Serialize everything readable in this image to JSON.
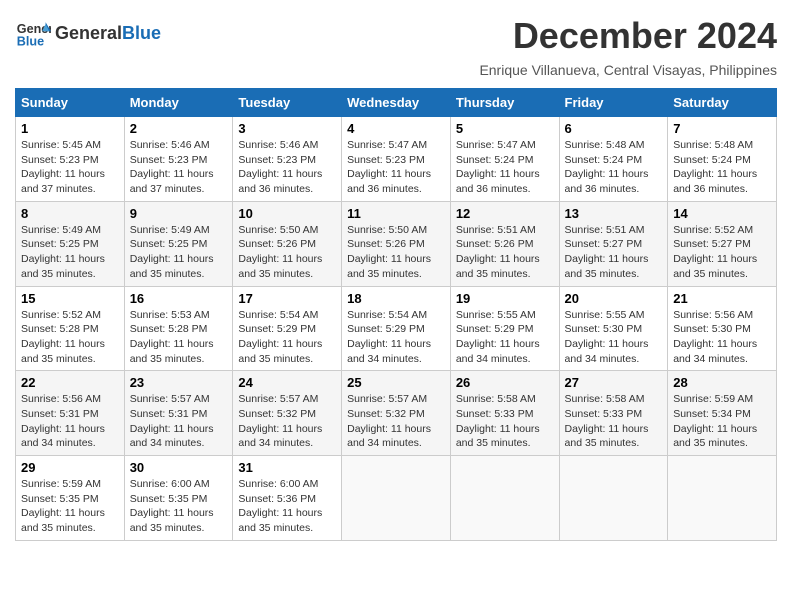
{
  "header": {
    "logo_general": "General",
    "logo_blue": "Blue",
    "month_title": "December 2024",
    "subtitle": "Enrique Villanueva, Central Visayas, Philippines"
  },
  "weekdays": [
    "Sunday",
    "Monday",
    "Tuesday",
    "Wednesday",
    "Thursday",
    "Friday",
    "Saturday"
  ],
  "weeks": [
    [
      {
        "day": "1",
        "sunrise": "5:45 AM",
        "sunset": "5:23 PM",
        "daylight": "11 hours and 37 minutes."
      },
      {
        "day": "2",
        "sunrise": "5:46 AM",
        "sunset": "5:23 PM",
        "daylight": "11 hours and 37 minutes."
      },
      {
        "day": "3",
        "sunrise": "5:46 AM",
        "sunset": "5:23 PM",
        "daylight": "11 hours and 36 minutes."
      },
      {
        "day": "4",
        "sunrise": "5:47 AM",
        "sunset": "5:23 PM",
        "daylight": "11 hours and 36 minutes."
      },
      {
        "day": "5",
        "sunrise": "5:47 AM",
        "sunset": "5:24 PM",
        "daylight": "11 hours and 36 minutes."
      },
      {
        "day": "6",
        "sunrise": "5:48 AM",
        "sunset": "5:24 PM",
        "daylight": "11 hours and 36 minutes."
      },
      {
        "day": "7",
        "sunrise": "5:48 AM",
        "sunset": "5:24 PM",
        "daylight": "11 hours and 36 minutes."
      }
    ],
    [
      {
        "day": "8",
        "sunrise": "5:49 AM",
        "sunset": "5:25 PM",
        "daylight": "11 hours and 35 minutes."
      },
      {
        "day": "9",
        "sunrise": "5:49 AM",
        "sunset": "5:25 PM",
        "daylight": "11 hours and 35 minutes."
      },
      {
        "day": "10",
        "sunrise": "5:50 AM",
        "sunset": "5:26 PM",
        "daylight": "11 hours and 35 minutes."
      },
      {
        "day": "11",
        "sunrise": "5:50 AM",
        "sunset": "5:26 PM",
        "daylight": "11 hours and 35 minutes."
      },
      {
        "day": "12",
        "sunrise": "5:51 AM",
        "sunset": "5:26 PM",
        "daylight": "11 hours and 35 minutes."
      },
      {
        "day": "13",
        "sunrise": "5:51 AM",
        "sunset": "5:27 PM",
        "daylight": "11 hours and 35 minutes."
      },
      {
        "day": "14",
        "sunrise": "5:52 AM",
        "sunset": "5:27 PM",
        "daylight": "11 hours and 35 minutes."
      }
    ],
    [
      {
        "day": "15",
        "sunrise": "5:52 AM",
        "sunset": "5:28 PM",
        "daylight": "11 hours and 35 minutes."
      },
      {
        "day": "16",
        "sunrise": "5:53 AM",
        "sunset": "5:28 PM",
        "daylight": "11 hours and 35 minutes."
      },
      {
        "day": "17",
        "sunrise": "5:54 AM",
        "sunset": "5:29 PM",
        "daylight": "11 hours and 35 minutes."
      },
      {
        "day": "18",
        "sunrise": "5:54 AM",
        "sunset": "5:29 PM",
        "daylight": "11 hours and 34 minutes."
      },
      {
        "day": "19",
        "sunrise": "5:55 AM",
        "sunset": "5:29 PM",
        "daylight": "11 hours and 34 minutes."
      },
      {
        "day": "20",
        "sunrise": "5:55 AM",
        "sunset": "5:30 PM",
        "daylight": "11 hours and 34 minutes."
      },
      {
        "day": "21",
        "sunrise": "5:56 AM",
        "sunset": "5:30 PM",
        "daylight": "11 hours and 34 minutes."
      }
    ],
    [
      {
        "day": "22",
        "sunrise": "5:56 AM",
        "sunset": "5:31 PM",
        "daylight": "11 hours and 34 minutes."
      },
      {
        "day": "23",
        "sunrise": "5:57 AM",
        "sunset": "5:31 PM",
        "daylight": "11 hours and 34 minutes."
      },
      {
        "day": "24",
        "sunrise": "5:57 AM",
        "sunset": "5:32 PM",
        "daylight": "11 hours and 34 minutes."
      },
      {
        "day": "25",
        "sunrise": "5:57 AM",
        "sunset": "5:32 PM",
        "daylight": "11 hours and 34 minutes."
      },
      {
        "day": "26",
        "sunrise": "5:58 AM",
        "sunset": "5:33 PM",
        "daylight": "11 hours and 35 minutes."
      },
      {
        "day": "27",
        "sunrise": "5:58 AM",
        "sunset": "5:33 PM",
        "daylight": "11 hours and 35 minutes."
      },
      {
        "day": "28",
        "sunrise": "5:59 AM",
        "sunset": "5:34 PM",
        "daylight": "11 hours and 35 minutes."
      }
    ],
    [
      {
        "day": "29",
        "sunrise": "5:59 AM",
        "sunset": "5:35 PM",
        "daylight": "11 hours and 35 minutes."
      },
      {
        "day": "30",
        "sunrise": "6:00 AM",
        "sunset": "5:35 PM",
        "daylight": "11 hours and 35 minutes."
      },
      {
        "day": "31",
        "sunrise": "6:00 AM",
        "sunset": "5:36 PM",
        "daylight": "11 hours and 35 minutes."
      },
      null,
      null,
      null,
      null
    ]
  ]
}
